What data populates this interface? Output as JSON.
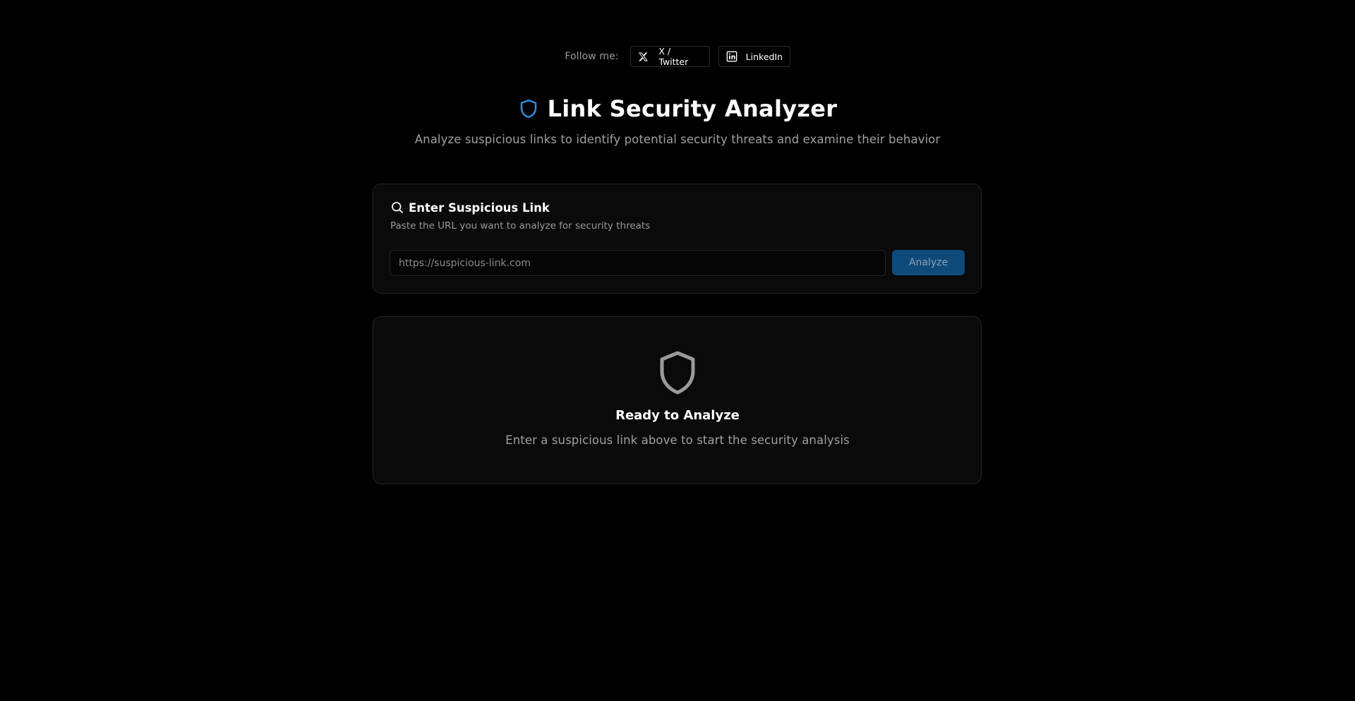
{
  "follow": {
    "label": "Follow me:",
    "links": [
      {
        "label": "X / Twitter",
        "icon": "x-twitter-icon"
      },
      {
        "label": "LinkedIn",
        "icon": "linkedin-icon"
      }
    ]
  },
  "header": {
    "title": "Link Security Analyzer",
    "subtitle": "Analyze suspicious links to identify potential security threats and examine their behavior",
    "icon": "shield-icon",
    "icon_color": "#2f8fe0"
  },
  "input_card": {
    "icon": "search-icon",
    "title": "Enter Suspicious Link",
    "description": "Paste the URL you want to analyze for security threats",
    "url_placeholder": "https://suspicious-link.com",
    "url_value": "",
    "analyze_label": "Analyze",
    "analyze_color": "#0e4a7a"
  },
  "status_card": {
    "icon": "shield-icon",
    "title": "Ready to Analyze",
    "description": "Enter a suspicious link above to start the security analysis"
  }
}
